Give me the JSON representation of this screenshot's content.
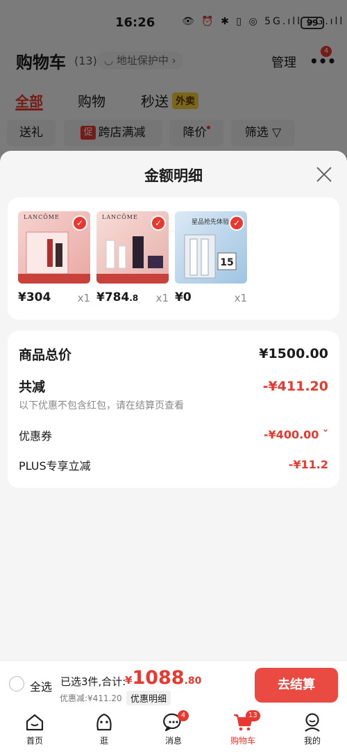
{
  "status_bar": {
    "time": "16:26",
    "icons": "👁 ⏰ ✱ ▯ ◎ 5G.ıll 5G.ıll",
    "battery": "99"
  },
  "header": {
    "title": "购物车",
    "count": "(13)",
    "address_pill": "◡ 地址保护中 ›",
    "manage": "管理",
    "more_badge": "4"
  },
  "tabs": [
    {
      "label": "全部"
    },
    {
      "label": "购物"
    },
    {
      "label": "秒送"
    }
  ],
  "waimai_badge": "外卖",
  "chips": {
    "gift": "送礼",
    "promo_tag": "促",
    "cross_store": "跨店满减",
    "price_drop": "降价",
    "filter": "筛选 ▽"
  },
  "sheet": {
    "title": "金额明细",
    "products": [
      {
        "brand": "LANCÔME",
        "price_int": "¥304",
        "price_dec": "",
        "qty": "x1",
        "color_a": "#f6d3cf",
        "color_b": "#e9a8a3"
      },
      {
        "brand": "LANCÔME",
        "price_int": "¥784",
        "price_dec": ".8",
        "qty": "x1",
        "color_a": "#f8dcd8",
        "color_b": "#e6b0aa"
      },
      {
        "brand": "星品抢先体验",
        "price_int": "¥0",
        "price_dec": "",
        "qty": "x1",
        "color_a": "#dbe9f5",
        "color_b": "#9fc4e2"
      }
    ],
    "total_label": "商品总价",
    "total_value": "¥1500.00",
    "discount_label": "共减",
    "discount_value": "-¥411.20",
    "discount_note": "以下优惠不包含红包，请在结算页查看",
    "coupon_label": "优惠券",
    "coupon_value": "-¥400.00 ˇ",
    "plus_label": "PLUS专享立减",
    "plus_value": "-¥11.2"
  },
  "checkout": {
    "select_all": "全选",
    "selected_text": "已选3件,合计:",
    "yen": "¥",
    "total_int": "1088",
    "total_dec": ".80",
    "discount_text": "优惠减:¥411.20",
    "detail_button": "优惠明细",
    "pay_button": "去结算"
  },
  "tabbar": [
    {
      "label": "首页",
      "icon": "home-icon"
    },
    {
      "label": "逛",
      "icon": "browse-icon"
    },
    {
      "label": "消息",
      "icon": "message-icon",
      "badge": "4"
    },
    {
      "label": "购物车",
      "icon": "cart-icon",
      "badge": "13"
    },
    {
      "label": "我的",
      "icon": "profile-icon"
    }
  ],
  "colors": {
    "accent": "#e8382f",
    "pay_button": "#e94b42",
    "overlay": "rgba(0,0,0,0.5)"
  }
}
